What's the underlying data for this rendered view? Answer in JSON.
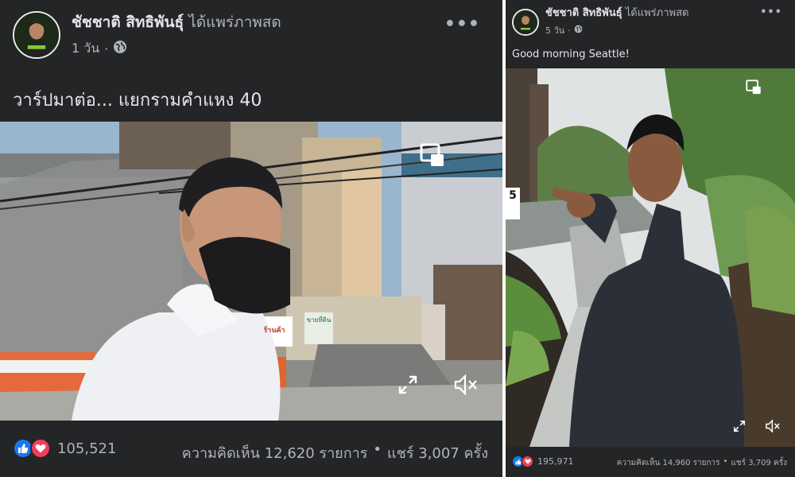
{
  "left_post": {
    "author": "ชัชชาติ สิทธิพันธุ์",
    "action": "ได้แพร่ภาพสด",
    "time": "1 วัน",
    "caption": "วาร์ปมาต่อ... แยกรามคำแหง 40",
    "reaction_count": "105,521",
    "comments": "ความคิดเห็น 12,620 รายการ",
    "separator": "•",
    "shares": "แชร์ 3,007 ครั้ง",
    "signs": {
      "shop_sign": "ร้านค้า",
      "banner": "ขายที่ดิน"
    }
  },
  "right_post": {
    "author": "ชัชชาติ สิทธิพันธุ์",
    "action": "ได้แพร่ภาพสด",
    "time": "5 วัน",
    "caption": "Good morning Seattle!",
    "reaction_count": "195,971",
    "comments": "ความคิดเห็น 14,960 รายการ",
    "separator": "•",
    "shares": "แชร์ 3,709 ครั้ง",
    "house_number": "5"
  },
  "icons": {
    "more": "more-horizontal-icon",
    "globe": "globe-icon",
    "pip": "picture-in-picture-icon",
    "fullscreen": "fullscreen-icon",
    "mute": "muted-speaker-icon",
    "like": "like-thumb-icon",
    "love": "love-heart-icon"
  },
  "colors": {
    "panel_bg": "#242526",
    "text_primary": "#e4e6eb",
    "text_secondary": "#b0b3b8",
    "like_blue": "#1877f2",
    "love_red": "#f33e58"
  }
}
